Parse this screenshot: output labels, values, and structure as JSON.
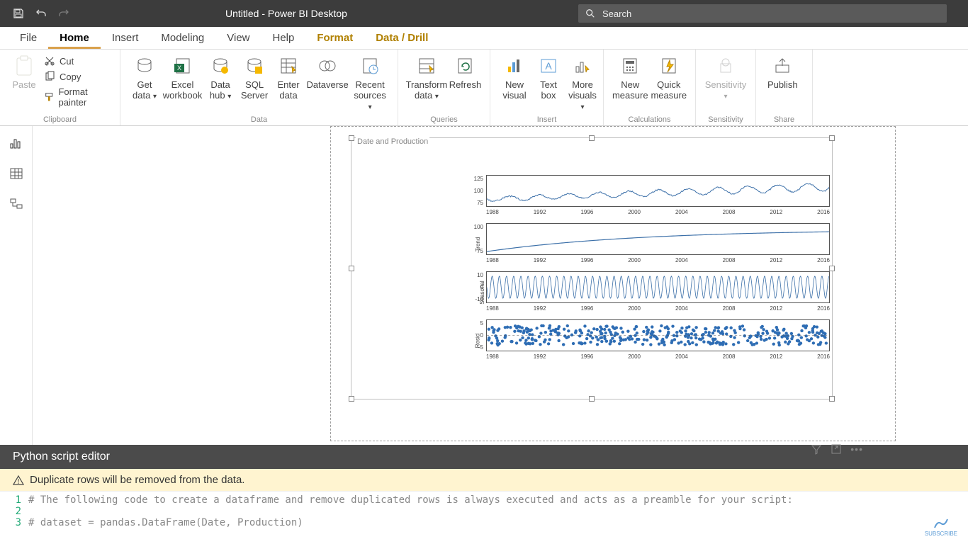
{
  "titlebar": {
    "title": "Untitled - Power BI Desktop",
    "search_placeholder": "Search"
  },
  "tabs": {
    "file": "File",
    "home": "Home",
    "insert": "Insert",
    "modeling": "Modeling",
    "view": "View",
    "help": "Help",
    "format": "Format",
    "drill": "Data / Drill"
  },
  "ribbon": {
    "clipboard": {
      "group": "Clipboard",
      "paste": "Paste",
      "cut": "Cut",
      "copy": "Copy",
      "format_painter": "Format painter"
    },
    "data": {
      "group": "Data",
      "get_data": "Get\ndata",
      "excel": "Excel\nworkbook",
      "data_hub": "Data\nhub",
      "sql": "SQL\nServer",
      "enter": "Enter\ndata",
      "dataverse": "Dataverse",
      "recent": "Recent\nsources"
    },
    "queries": {
      "group": "Queries",
      "transform": "Transform\ndata",
      "refresh": "Refresh"
    },
    "insert": {
      "group": "Insert",
      "new_visual": "New\nvisual",
      "text_box": "Text\nbox",
      "more": "More\nvisuals"
    },
    "calc": {
      "group": "Calculations",
      "new_measure": "New\nmeasure",
      "quick": "Quick\nmeasure"
    },
    "sens": {
      "group": "Sensitivity",
      "label": "Sensitivity"
    },
    "share": {
      "group": "Share",
      "publish": "Publish"
    }
  },
  "visual": {
    "title": "Date and Production"
  },
  "editor": {
    "header": "Python script editor",
    "warning": "Duplicate rows will be removed from the data.",
    "lines": {
      "l1n": "1",
      "l1": "# The following code to create a dataframe and remove duplicated rows is always executed and acts as a preamble for your script:",
      "l2n": "2",
      "l2": "",
      "l3n": "3",
      "l3": "# dataset = pandas.DataFrame(Date, Production)"
    }
  },
  "chart_data": [
    {
      "type": "line",
      "title": "",
      "ylabel": "",
      "yticks": [
        "125",
        "100",
        "75"
      ],
      "xticks": [
        "1988",
        "1992",
        "1996",
        "2000",
        "2004",
        "2008",
        "2012",
        "2016"
      ],
      "ylim": [
        65,
        130
      ],
      "note": "observed production series; seasonal noisy line trending up from ~75 to ~110"
    },
    {
      "type": "line",
      "title": "",
      "ylabel": "Trend",
      "yticks": [
        "100",
        "75"
      ],
      "xticks": [
        "1988",
        "1992",
        "1996",
        "2000",
        "2004",
        "2008",
        "2012",
        "2016"
      ],
      "ylim": [
        65,
        110
      ],
      "note": "smooth trend rising from ~68 to ~105 leveling off after 2008"
    },
    {
      "type": "line",
      "title": "",
      "ylabel": "Seasonal",
      "yticks": [
        "10",
        "0",
        "-10"
      ],
      "xticks": [
        "1988",
        "1992",
        "1996",
        "2000",
        "2004",
        "2008",
        "2012",
        "2016"
      ],
      "ylim": [
        -12,
        12
      ],
      "note": "repeating annual seasonal oscillation amplitude ~10"
    },
    {
      "type": "scatter",
      "title": "",
      "ylabel": "Resid",
      "yticks": [
        "5",
        "0",
        "-5"
      ],
      "xticks": [
        "1988",
        "1992",
        "1996",
        "2000",
        "2004",
        "2008",
        "2012",
        "2016"
      ],
      "ylim": [
        -7,
        7
      ],
      "note": "residual scatter around zero"
    }
  ]
}
